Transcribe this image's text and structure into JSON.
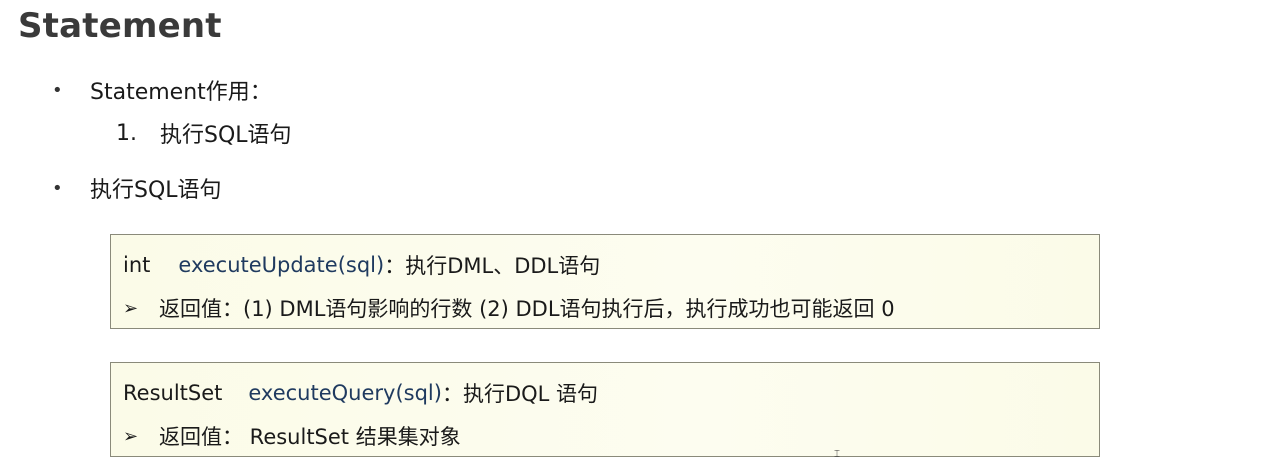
{
  "title": "Statement",
  "bullets": [
    {
      "label": "Statement作用：",
      "sub": {
        "num": "1.",
        "text": "执行SQL语句"
      }
    },
    {
      "label": "执行SQL语句"
    }
  ],
  "boxes": [
    {
      "type": "int",
      "method": "executeUpdate(sql)",
      "desc": "：执行DML、DDL语句",
      "return_text": "返回值：(1) DML语句影响的行数 (2) DDL语句执行后，执行成功也可能返回 0"
    },
    {
      "type": "ResultSet",
      "method": "executeQuery(sql)",
      "desc": "：执行DQL 语句",
      "return_text": "返回值： ResultSet 结果集对象"
    }
  ],
  "bullet_symbol": "•",
  "arrow_symbol": "➢"
}
